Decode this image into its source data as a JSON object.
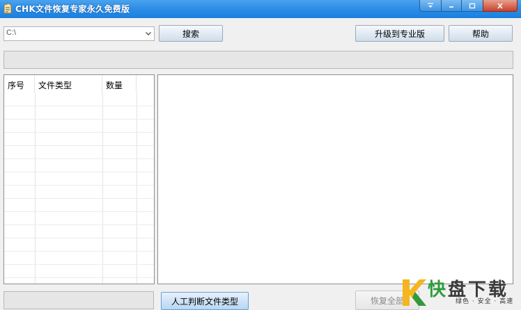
{
  "window": {
    "title": "CHK文件恢复专家永久免费版",
    "controls": {
      "menu_icon": "dropdown-icon",
      "minimize_icon": "minimize-icon",
      "maximize_icon": "maximize-icon",
      "close_icon": "close-icon"
    }
  },
  "toolbar": {
    "drive_value": "C:\\",
    "search_label": "搜索",
    "upgrade_label": "升级到专业版",
    "help_label": "帮助"
  },
  "list": {
    "columns": [
      "序号",
      "文件类型",
      "数量"
    ]
  },
  "bottom": {
    "judge_label": "人工判断文件类型",
    "recover_label": "恢复全部"
  },
  "watermark": {
    "brand_first": "快",
    "brand_rest": "盘下载",
    "tagline": "绿色 · 安全 · 高速"
  },
  "colors": {
    "titlebar": "#2f8ee6",
    "watermark_green": "#2f9b3c"
  }
}
